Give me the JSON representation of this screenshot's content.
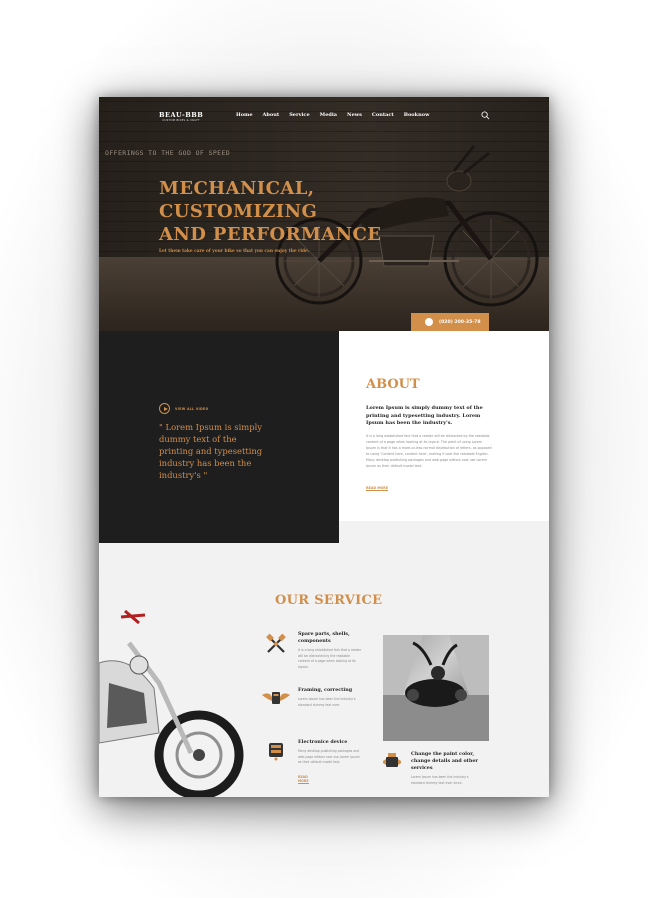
{
  "brand": {
    "name": "BEAU-BBB",
    "tagline": "CUSTOM BIKES & CRAFT",
    "accent": "#d18f4a",
    "dark": "#1e1e1e"
  },
  "nav": {
    "items": [
      "Home",
      "About",
      "Service",
      "Media",
      "News",
      "Contact",
      "Booknow"
    ],
    "search_icon": "search-icon"
  },
  "hero": {
    "wall_sign": "OFFERINGS TO THE GOD OF SPEED",
    "title_lines": [
      "MECHANICAL,",
      "CUSTOMIZING",
      "AND PERFORMANCE"
    ],
    "subtitle": "Let them take care of your bike so that you can enjoy the ride.",
    "phone": "(020) 200-35-78"
  },
  "feature": {
    "view_all": "VIEW ALL VIDEO",
    "quote": "\" Lorem Ipsum is simply dummy text of the printing and typesetting industry has been the industry's \""
  },
  "about": {
    "title": "ABOUT",
    "lead": "Lorem Ipsum is simply dummy text of the printing and typesetting industry. Lorem Ipsum has been the industry's.",
    "body": "It is a long established fact that a reader will be distracted by the readable content of a page when looking at its layout. The point of using Lorem Ipsum is that it has a more-or-less normal distribution of letters, as opposed to using 'Content here, content here', making it look like readable English. Many desktop publishing packages and web page editors now use Lorem Ipsum as their default model text.",
    "read_more": "READ MORE"
  },
  "service": {
    "title": "OUR SERVICE",
    "items": [
      {
        "name": "Spare parts, shells, components",
        "desc": "It is a long established fact that a reader will be distracted by the readable content of a page when looking at its layout.",
        "icon": "pistons-icon"
      },
      {
        "name": "Framing, correcting",
        "desc": "Lorem Ipsum has been the industry's standard dummy text ever.",
        "icon": "engine-wings-icon"
      },
      {
        "name": "Electronice device",
        "desc": "Many desktop publishing packages and web page editors now use Lorem Ipsum as their default model text.",
        "icon": "engine-block-icon",
        "link": "READ MORE"
      },
      {
        "name": "Change the paint color, change details and other services",
        "desc": "Lorem Ipsum has been the industry's standard dummy text ever since.",
        "icon": "paint-engine-icon"
      }
    ]
  }
}
